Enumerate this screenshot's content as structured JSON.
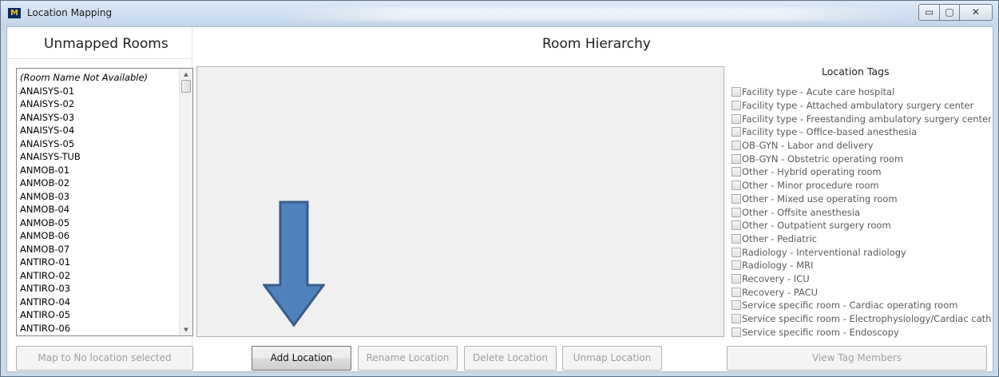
{
  "window": {
    "title": "Location Mapping",
    "icon_letter": "M",
    "controls": {
      "minimize": "▭",
      "maximize": "▢",
      "close": "✕"
    }
  },
  "unmapped": {
    "heading": "Unmapped Rooms",
    "items": [
      "(Room Name Not Available)",
      "ANAISYS-01",
      "ANAISYS-02",
      "ANAISYS-03",
      "ANAISYS-04",
      "ANAISYS-05",
      "ANAISYS-TUB",
      "ANMOB-01",
      "ANMOB-02",
      "ANMOB-03",
      "ANMOB-04",
      "ANMOB-05",
      "ANMOB-06",
      "ANMOB-07",
      "ANTIRO-01",
      "ANTIRO-02",
      "ANTIRO-03",
      "ANTIRO-04",
      "ANTIRO-05",
      "ANTIRO-06"
    ],
    "map_button": "Map to No location selected"
  },
  "hierarchy": {
    "heading": "Room Hierarchy",
    "buttons": {
      "add": "Add Location",
      "rename": "Rename Location",
      "delete": "Delete Location",
      "unmap": "Unmap Location"
    }
  },
  "tags": {
    "heading": "Location Tags",
    "items": [
      "Facility type - Acute care hospital",
      "Facility type - Attached ambulatory surgery center",
      "Facility type - Freestanding ambulatory surgery center",
      "Facility type - Office-based anesthesia",
      "OB-GYN - Labor and delivery",
      "OB-GYN - Obstetric operating room",
      "Other - Hybrid operating room",
      "Other - Minor procedure room",
      "Other - Mixed use operating room",
      "Other - Offsite anesthesia",
      "Other - Outpatient surgery room",
      "Other - Pediatric",
      "Radiology - Interventional radiology",
      "Radiology - MRI",
      "Recovery - ICU",
      "Recovery - PACU",
      "Service specific room - Cardiac operating room",
      "Service specific room - Electrophysiology/Cardiac cath",
      "Service specific room - Endoscopy"
    ],
    "view_button": "View Tag Members"
  },
  "colors": {
    "arrow_fill": "#4f81bd",
    "arrow_stroke": "#385d8a"
  }
}
